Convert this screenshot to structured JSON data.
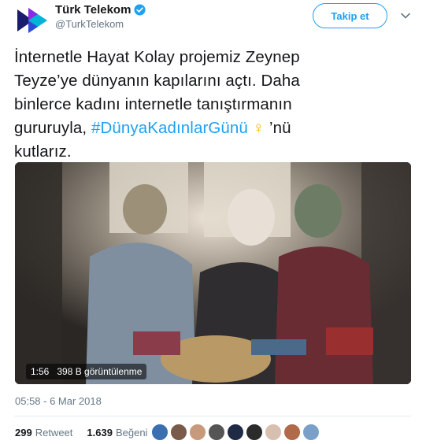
{
  "account": {
    "name": "Türk Telekom",
    "handle": "@TurkTelekom",
    "verified_icon": "verified-badge-icon",
    "brand_colors": [
      "#00b4d8",
      "#8a2be2",
      "#1a1a6e"
    ]
  },
  "actions": {
    "follow_label": "Takip et",
    "more_icon": "chevron-down-icon"
  },
  "tweet": {
    "lines": [
      "İnternetle Hayat Kolay projemiz Zeynep",
      "Teyze’ye dünyanın kapılarını açtı. Daha",
      "binlerce kadını internetle tanıştırmanın"
    ],
    "line4_prefix": "gururuyla, ",
    "hashtag": "#DünyaKadınlarGünü",
    "emoji": "♀",
    "line4_suffix": " ’nü",
    "line5": "kutlarız."
  },
  "video": {
    "duration": "1:56",
    "views": "398 B görüntülenme"
  },
  "timestamp": "05:58 - 6 Mar 2018",
  "stats": {
    "retweets": "299",
    "retweets_label": "Retweet",
    "likes": "1.639",
    "likes_label": "Beğeni"
  },
  "colors": {
    "accent": "#1da1f2",
    "text": "#14171a",
    "secondary": "#657786",
    "divider": "#e6ecf0"
  }
}
